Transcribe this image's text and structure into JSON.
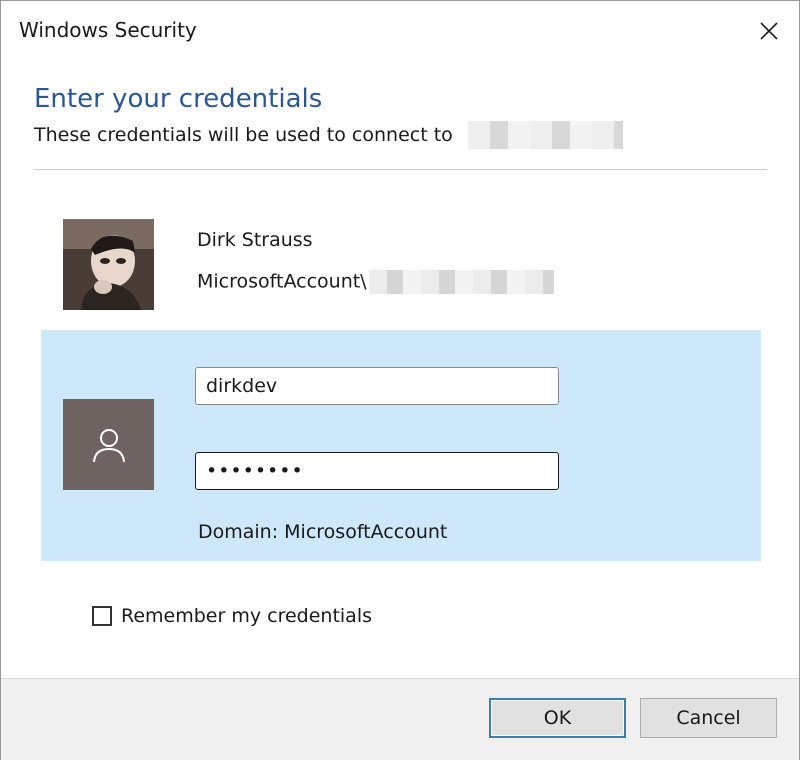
{
  "window": {
    "title": "Windows Security",
    "close_icon": "close-icon"
  },
  "header": {
    "heading": "Enter your credentials",
    "subheading": "These credentials will be used to connect to"
  },
  "account": {
    "name": "Dirk Strauss",
    "account_prefix": "MicrosoftAccount\\",
    "avatar_icon": "user-photo"
  },
  "credentials": {
    "tile_icon": "person-icon",
    "username_value": "dirkdev",
    "password_value": "••••••••",
    "domain_label": "Domain: MicrosoftAccount",
    "panel_color": "#cce8fa"
  },
  "options": {
    "remember_label": "Remember my credentials",
    "remember_checked": false
  },
  "footer": {
    "ok_label": "OK",
    "cancel_label": "Cancel"
  },
  "colors": {
    "heading": "#2b5797",
    "accent": "#3c7fb1"
  }
}
